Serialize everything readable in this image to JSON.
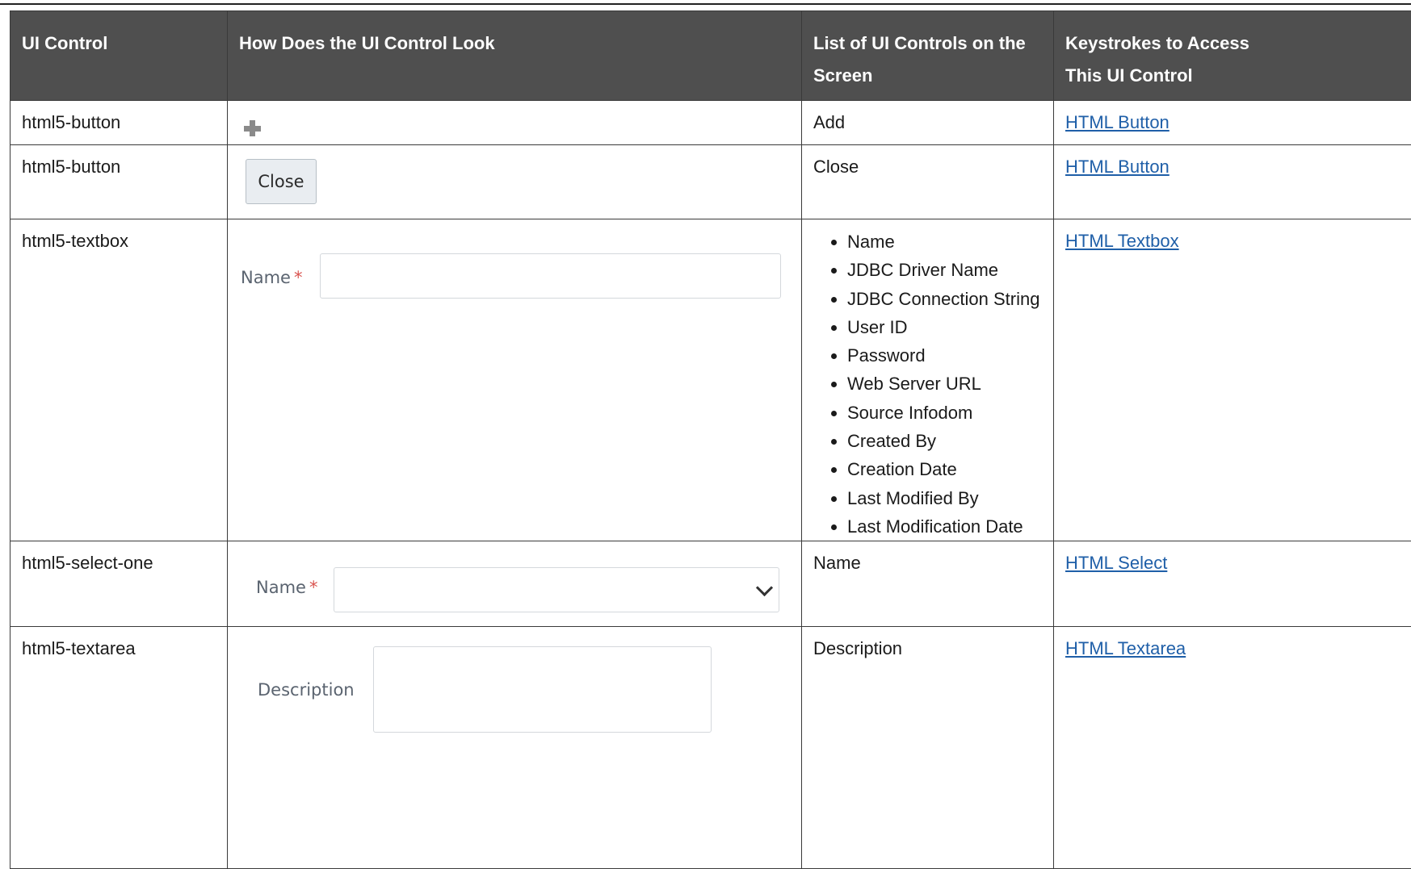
{
  "table": {
    "headers": [
      "UI Control",
      "How Does the UI Control Look",
      [
        "List of UI Controls on the",
        "Screen"
      ],
      [
        "Keystrokes to Access",
        "This UI Control"
      ]
    ],
    "rows": [
      {
        "control": "html5-button",
        "look": {
          "type": "plus-icon"
        },
        "list": "Add",
        "keystroke_link": "HTML Button"
      },
      {
        "control": "html5-button",
        "look": {
          "type": "button",
          "label": "Close"
        },
        "list": "Close",
        "keystroke_link": "HTML Button"
      },
      {
        "control": "html5-textbox",
        "look": {
          "type": "textbox",
          "label": "Name",
          "required_mark": "*"
        },
        "list_items": [
          "Name",
          "JDBC Driver Name",
          "JDBC Connection String",
          "User ID",
          "Password",
          "Web Server URL",
          "Source Infodom",
          "Created By",
          "Creation Date",
          "Last Modified By",
          "Last Modification Date"
        ],
        "keystroke_link": "HTML Textbox"
      },
      {
        "control": "html5-select-one",
        "look": {
          "type": "select",
          "label": "Name",
          "required_mark": "*"
        },
        "list": "Name",
        "keystroke_link": "HTML Select"
      },
      {
        "control": "html5-textarea",
        "look": {
          "type": "textarea",
          "label": "Description"
        },
        "list": "Description",
        "keystroke_link": "HTML Textarea"
      }
    ]
  }
}
